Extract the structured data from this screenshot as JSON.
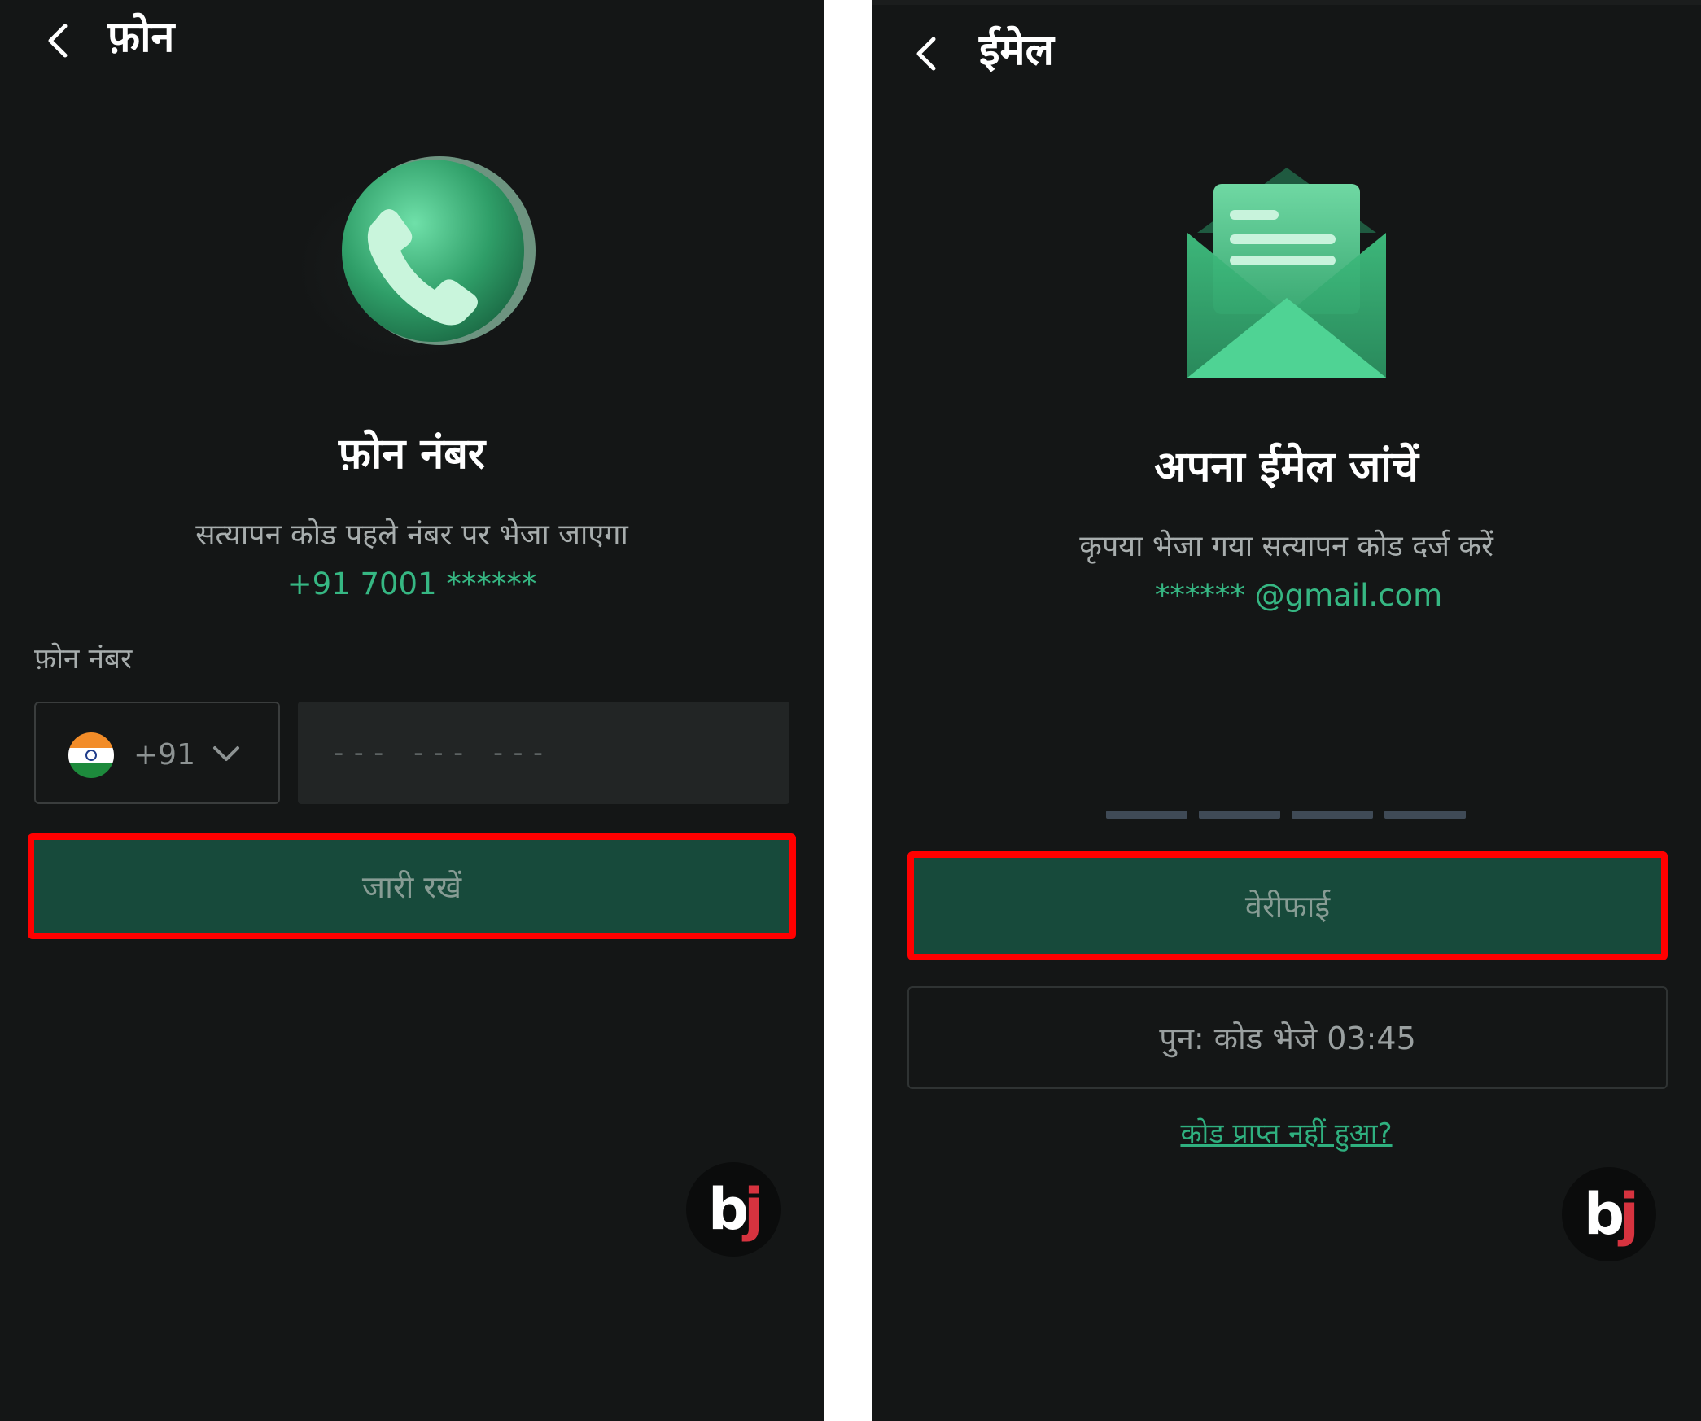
{
  "phone_screen": {
    "header_title": "फ़ोन",
    "title": "फ़ोन नंबर",
    "subtitle": "सत्यापन कोड पहले नंबर पर भेजा जाएगा",
    "masked_number": "+91 7001 ******",
    "field_label": "फ़ोन नंबर",
    "country_code": "+91",
    "phone_placeholder": "--- --- ---",
    "continue_button": "जारी रखें",
    "logo_b": "b",
    "logo_j": "j"
  },
  "email_screen": {
    "header_title": "ईमेल",
    "title": "अपना ईमेल जांचें",
    "subtitle": "कृपया भेजा गया सत्यापन कोड दर्ज करें",
    "masked_email": "****** @gmail.com",
    "verify_button": "वेरीफाई",
    "resend_button": "पुन: कोड भेजे 03:45",
    "no_code_link": "कोड प्राप्त नहीं हुआ?",
    "logo_b": "b",
    "logo_j": "j"
  },
  "colors": {
    "background": "#141616",
    "accent": "#36b783",
    "button": "#174a3b",
    "highlight": "#ff0000"
  }
}
